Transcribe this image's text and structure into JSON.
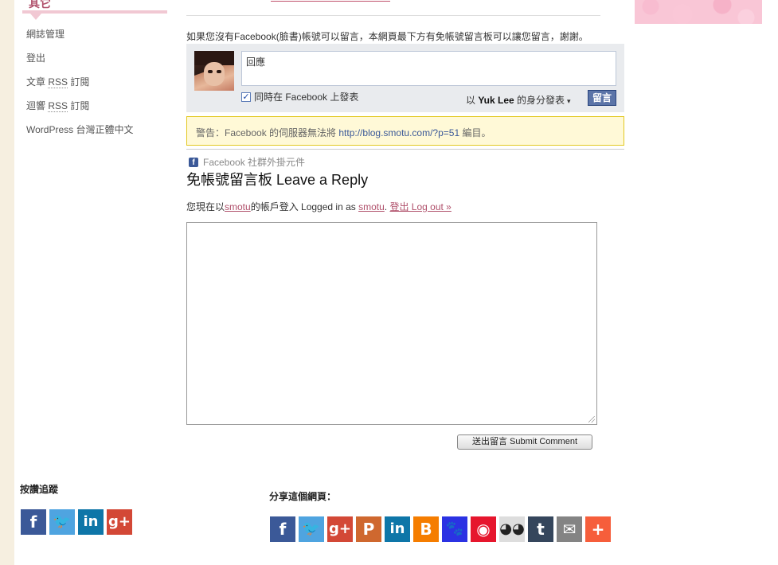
{
  "sidebar": {
    "heading": "其它",
    "items": [
      {
        "label": "網誌管理"
      },
      {
        "label": "登出"
      },
      {
        "label_a": "文章 ",
        "label_rss": "RSS",
        "label_b": " 訂閱"
      },
      {
        "label_a": "迴響 ",
        "label_rss": "RSS",
        "label_b": " 訂閱"
      },
      {
        "label": "WordPress 台灣正體中文"
      }
    ]
  },
  "main": {
    "fb_note": "如果您沒有Facebook(臉書)帳號可以留言，本網頁最下方有免帳號留言板可以讓您留言，謝謝。",
    "fb_box": {
      "input_placeholder": "回應",
      "checkbox_label": "同時在 Facebook 上發表",
      "post_as_prefix": "以 ",
      "post_as_name": "Yuk Lee",
      "post_as_suffix": " 的身分發表",
      "caret": "▾",
      "post_button": "留言"
    },
    "warning": {
      "prefix": "警告：Facebook 的伺服器無法將 ",
      "url": "http://blog.smotu.com/?p=51",
      "suffix": " 編目。"
    },
    "plugin_label": "Facebook 社群外掛元件",
    "reply_title": "免帳號留言板 Leave a Reply",
    "logged_in": {
      "part1": "您現在以",
      "user1": "smotu",
      "part2": "的帳戶登入 Logged in as ",
      "user2": "smotu",
      "part3": ". ",
      "logout": "登出 Log out »"
    },
    "submit_button": "送出留言 Submit Comment"
  },
  "footer": {
    "follow_label": "按讚追蹤",
    "follow_icons": [
      {
        "name": "facebook-icon",
        "glyph": "f",
        "color": "#3b5998"
      },
      {
        "name": "twitter-icon",
        "glyph": "🐦",
        "color": "#4fa4e0"
      },
      {
        "name": "linkedin-icon",
        "glyph": "in",
        "color": "#0e76a8"
      },
      {
        "name": "google-plus-icon",
        "glyph": "g+",
        "color": "#d34836"
      }
    ],
    "share_label": "分享這個網頁：",
    "share_icons": [
      {
        "name": "facebook-icon",
        "glyph": "f",
        "color": "#3b5998"
      },
      {
        "name": "twitter-icon",
        "glyph": "🐦",
        "color": "#4fa4e0"
      },
      {
        "name": "google-plus-icon",
        "glyph": "g+",
        "color": "#d34836"
      },
      {
        "name": "plurk-icon",
        "glyph": "P",
        "color": "#cf682f"
      },
      {
        "name": "linkedin-icon",
        "glyph": "in",
        "color": "#0e76a8"
      },
      {
        "name": "blogger-icon",
        "glyph": "B",
        "color": "#f57d00"
      },
      {
        "name": "baidu-paw-icon",
        "glyph": "🐾",
        "color": "#2b32e3"
      },
      {
        "name": "weibo-icon",
        "glyph": "◉",
        "color": "#e6162d"
      },
      {
        "name": "hootsuite-owl-icon",
        "glyph": "◕◕",
        "color": "#dddddd"
      },
      {
        "name": "tumblr-icon",
        "glyph": "t",
        "color": "#35465c"
      },
      {
        "name": "email-icon",
        "glyph": "✉",
        "color": "#848484"
      },
      {
        "name": "more-plus-icon",
        "glyph": "+",
        "color": "#f65e3b"
      }
    ]
  }
}
